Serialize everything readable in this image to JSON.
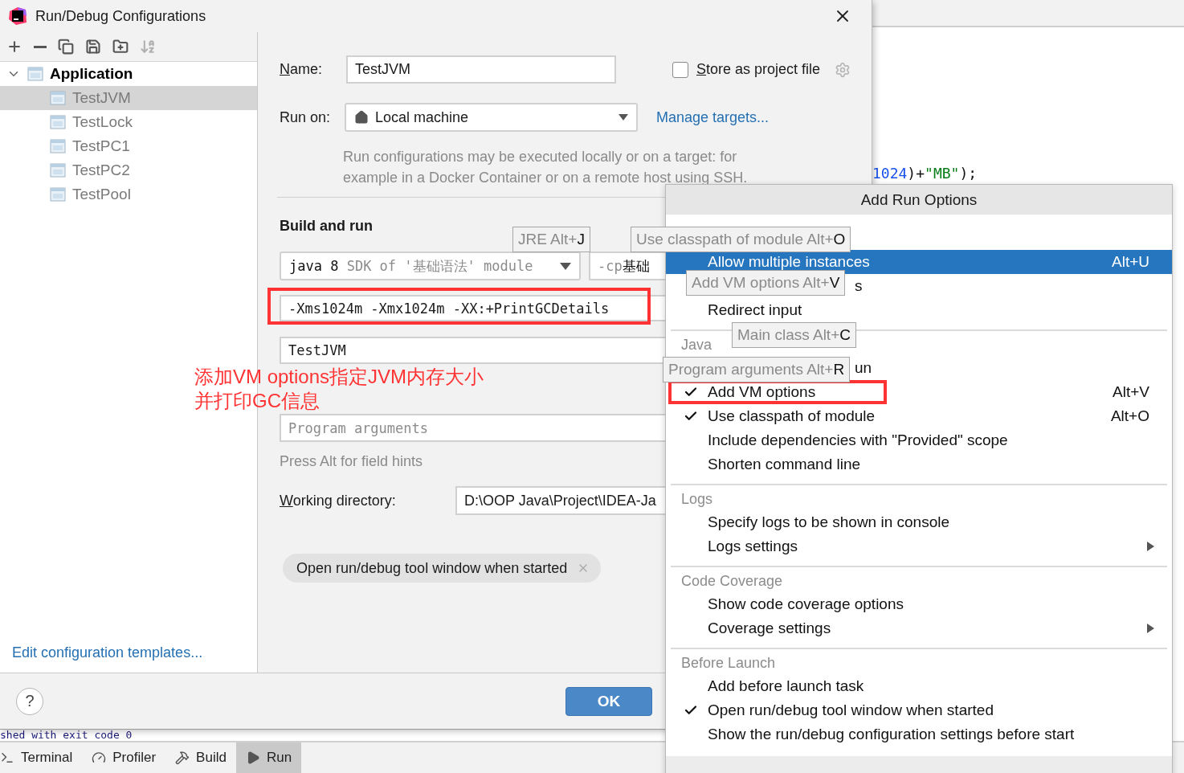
{
  "ide": {
    "code_line": [
      {
        "text": "1024",
        "kind": "number"
      },
      {
        "text": ")+",
        "kind": "plain"
      },
      {
        "text": "\"MB\"",
        "kind": "string"
      },
      {
        "text": ");",
        "kind": "plain"
      }
    ],
    "console_line": "shed with exit code 0",
    "tool_tabs": [
      {
        "label": "Terminal",
        "selected": false
      },
      {
        "label": "Profiler",
        "selected": false
      },
      {
        "label": "Build",
        "selected": false
      },
      {
        "label": "Run",
        "selected": true
      }
    ]
  },
  "dialog": {
    "title": "Run/Debug Configurations",
    "toolbar": [
      {
        "disabled": false
      },
      {
        "disabled": false
      },
      {
        "disabled": false
      },
      {
        "disabled": false
      },
      {
        "disabled": false
      },
      {
        "disabled": true
      }
    ],
    "tree": [
      {
        "label": "Application",
        "expanded": true,
        "selected": false,
        "children": [
          {
            "label": "TestJVM",
            "selected": true
          },
          {
            "label": "TestLock",
            "selected": false
          },
          {
            "label": "TestPC1",
            "selected": false
          },
          {
            "label": "TestPC2",
            "selected": false
          },
          {
            "label": "TestPool",
            "selected": false
          }
        ]
      }
    ],
    "templates_link": "Edit configuration templates...",
    "name": {
      "label": "Name:",
      "mnemonic": true,
      "value": "TestJVM"
    },
    "store_as_project_file": {
      "label": "Store as project file",
      "mnemonic": true,
      "checked": false
    },
    "run_on": {
      "label": "Run on:",
      "mnemonic": false,
      "value": "Local machine"
    },
    "manage_targets": "Manage targets...",
    "run_on_note": [
      "Run configurations may be executed locally or on a target: for",
      "example in a Docker Container or on a remote host using SSH."
    ],
    "build_and_run": {
      "heading": "Build and run",
      "jre": {
        "value": "java 8",
        "hint": "SDK of '基础语法' module"
      },
      "classpath": {
        "prefix": "-cp",
        "value": "基础"
      },
      "vm_options": {
        "value": "-Xms1024m -Xmx1024m -XX:+PrintGCDetails",
        "highlighted": true
      },
      "main_class": {
        "value": "TestJVM"
      },
      "program_arguments": {
        "placeholder": "Program arguments"
      }
    },
    "field_hints_note": "Press Alt for field hints",
    "working_directory": {
      "label": "Working directory:",
      "mnemonic": true,
      "value": "D:\\OOP Java\\Project\\IDEA-Ja"
    },
    "option_chips": [
      {
        "label": "Open run/debug tool window when started"
      }
    ],
    "help_button": "?",
    "ok_button": "OK"
  },
  "field_hints": [
    {
      "label": "JRE Alt+",
      "key": "J"
    },
    {
      "label": "Use classpath of module Alt+",
      "key": "O"
    },
    {
      "label": "Add VM options Alt+",
      "key": "V"
    },
    {
      "label": "Main class Alt+",
      "key": "C"
    },
    {
      "label": "Program arguments Alt+",
      "key": "R"
    }
  ],
  "run_options_popup": {
    "title": "Add Run Options",
    "sections": [
      {
        "items": [
          {
            "kind": "full",
            "label": "Allow multiple instances",
            "shortcut": "Alt+U",
            "checked": false,
            "selected": true,
            "submenu": false,
            "highlighted": false
          },
          {
            "kind": "partial",
            "label": "s",
            "checked": false,
            "selected": false,
            "submenu": false,
            "highlighted": false
          },
          {
            "kind": "full",
            "label": "Redirect input",
            "checked": false,
            "selected": false,
            "submenu": false,
            "highlighted": false
          }
        ]
      },
      {
        "heading": "Java",
        "items": [
          {
            "kind": "partial",
            "label": "un",
            "checked": false,
            "selected": false,
            "submenu": false,
            "highlighted": false
          },
          {
            "kind": "full",
            "label": "Add VM options",
            "shortcut": "Alt+V",
            "checked": true,
            "selected": false,
            "submenu": false,
            "highlighted": true
          },
          {
            "kind": "full",
            "label": "Use classpath of module",
            "shortcut": "Alt+O",
            "checked": true,
            "selected": false,
            "submenu": false,
            "highlighted": false
          },
          {
            "kind": "full",
            "label": "Include dependencies with \"Provided\" scope",
            "checked": false,
            "selected": false,
            "submenu": false,
            "highlighted": false
          },
          {
            "kind": "full",
            "label": "Shorten command line",
            "checked": false,
            "selected": false,
            "submenu": false,
            "highlighted": false
          }
        ]
      },
      {
        "heading": "Logs",
        "items": [
          {
            "kind": "full",
            "label": "Specify logs to be shown in console",
            "checked": false,
            "selected": false,
            "submenu": false,
            "highlighted": false
          },
          {
            "kind": "full",
            "label": "Logs settings",
            "checked": false,
            "selected": false,
            "submenu": true,
            "highlighted": false
          }
        ]
      },
      {
        "heading": "Code Coverage",
        "items": [
          {
            "kind": "full",
            "label": "Show code coverage options",
            "checked": false,
            "selected": false,
            "submenu": false,
            "highlighted": false
          },
          {
            "kind": "full",
            "label": "Coverage settings",
            "checked": false,
            "selected": false,
            "submenu": true,
            "highlighted": false
          }
        ]
      },
      {
        "heading": "Before Launch",
        "items": [
          {
            "kind": "full",
            "label": "Add before launch task",
            "checked": false,
            "selected": false,
            "submenu": false,
            "highlighted": false
          },
          {
            "kind": "full",
            "label": "Open run/debug tool window when started",
            "checked": true,
            "selected": false,
            "submenu": false,
            "highlighted": false
          },
          {
            "kind": "full",
            "label": "Show the run/debug configuration settings before start",
            "checked": false,
            "selected": false,
            "submenu": false,
            "highlighted": false
          }
        ]
      }
    ]
  },
  "annotation": {
    "lines": [
      "添加VM options指定JVM内存大小",
      "并打印GC信息"
    ]
  }
}
